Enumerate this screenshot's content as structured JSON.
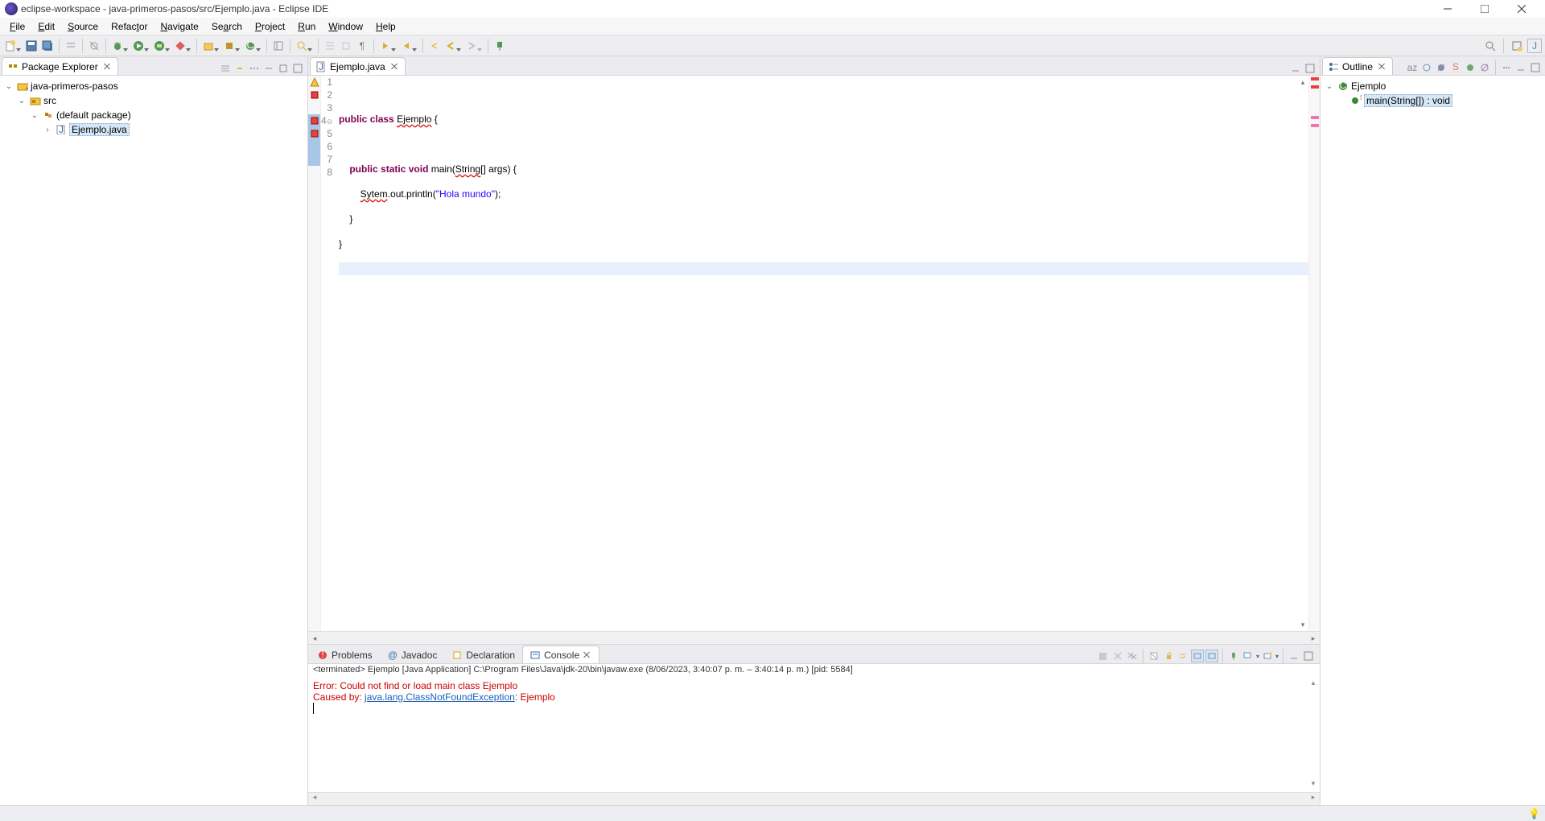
{
  "window": {
    "title": "eclipse-workspace - java-primeros-pasos/src/Ejemplo.java - Eclipse IDE"
  },
  "menu": [
    "File",
    "Edit",
    "Source",
    "Refactor",
    "Navigate",
    "Search",
    "Project",
    "Run",
    "Window",
    "Help"
  ],
  "packageExplorer": {
    "title": "Package Explorer",
    "project": "java-primeros-pasos",
    "src": "src",
    "pkg": "(default package)",
    "file": "Ejemplo.java"
  },
  "editor": {
    "tab": "Ejemplo.java",
    "linecount": 8,
    "code": {
      "l1": "",
      "l2_a": "public",
      "l2_b": " ",
      "l2_c": "class",
      "l2_d": " ",
      "l2_e": "Ejemplo",
      "l2_f": " {",
      "l3": "",
      "l4_a": "    ",
      "l4_b": "public",
      "l4_c": " ",
      "l4_d": "static",
      "l4_e": " ",
      "l4_f": "void",
      "l4_g": " main(",
      "l4_h": "String",
      "l4_i": "[] args) {",
      "l5_a": "        ",
      "l5_b": "Sytem",
      "l5_c": ".out.println(",
      "l5_d": "\"Hola mundo\"",
      "l5_e": ");",
      "l6": "    }",
      "l7": "}",
      "l8": ""
    }
  },
  "outline": {
    "title": "Outline",
    "class": "Ejemplo",
    "method": "main(String[]) : void"
  },
  "bottom": {
    "tabs": {
      "problems": "Problems",
      "javadoc": "Javadoc",
      "declaration": "Declaration",
      "console": "Console"
    },
    "desc": "<terminated> Ejemplo [Java Application] C:\\Program Files\\Java\\jdk-20\\bin\\javaw.exe  (8/06/2023, 3:40:07 p. m. – 3:40:14 p. m.) [pid: 5584]",
    "line1": "Error: Could not find or load main class Ejemplo",
    "line2a": "Caused by: ",
    "line2b": "java.lang.ClassNotFoundException",
    "line2c": ": Ejemplo"
  }
}
